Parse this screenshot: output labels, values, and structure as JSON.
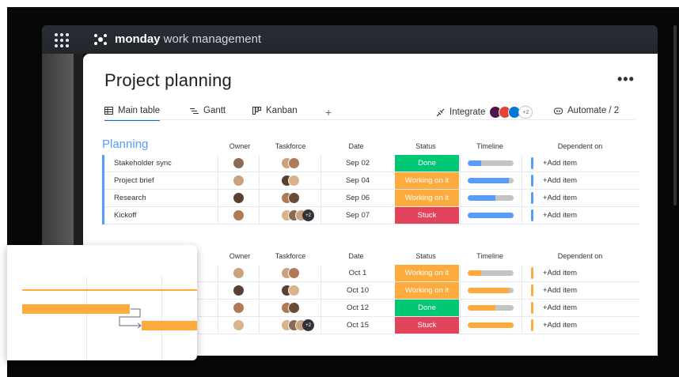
{
  "app": {
    "brand_bold": "monday",
    "brand_rest": " work management"
  },
  "page": {
    "title": "Project planning",
    "more_label": "•••"
  },
  "views": [
    {
      "label": "Main table"
    },
    {
      "label": "Gantt"
    },
    {
      "label": "Kanban"
    }
  ],
  "add_view": "+",
  "integrate": {
    "label": "Integrate",
    "count": "+2"
  },
  "automate": {
    "label": "Automate / 2"
  },
  "columns": {
    "owner": "Owner",
    "taskforce": "Taskforce",
    "date": "Date",
    "status": "Status",
    "timeline": "Timeline",
    "dependent": "Dependent on"
  },
  "groups": [
    {
      "title": "Planning",
      "color": "#579bfc",
      "rows": [
        {
          "name": "Stakeholder sync",
          "date": "Sep 02",
          "status": "Done",
          "status_color": "#00c875",
          "timeline": 0.3,
          "extra": "",
          "dep": "+Add item"
        },
        {
          "name": "Project brief",
          "date": "Sep 04",
          "status": "Working on it",
          "status_color": "#fdab3d",
          "timeline": 0.9,
          "extra": "",
          "dep": "+Add item"
        },
        {
          "name": "Research",
          "date": "Sep 06",
          "status": "Working on it",
          "status_color": "#fdab3d",
          "timeline": 0.6,
          "extra": "",
          "dep": "+Add item"
        },
        {
          "name": "Kickoff",
          "date": "Sep 07",
          "status": "Stuck",
          "status_color": "#e2445c",
          "timeline": 1.0,
          "extra": "+2",
          "dep": "+Add item"
        }
      ]
    },
    {
      "title": "",
      "color": "#fdab3d",
      "rows": [
        {
          "name": "",
          "date": "Oct 1",
          "status": "Working on it",
          "status_color": "#fdab3d",
          "timeline": 0.3,
          "extra": "",
          "dep": "+Add item"
        },
        {
          "name": "",
          "date": "Oct 10",
          "status": "Working on it",
          "status_color": "#fdab3d",
          "timeline": 0.9,
          "extra": "",
          "dep": "+Add item"
        },
        {
          "name": "",
          "date": "Oct 12",
          "status": "Done",
          "status_color": "#00c875",
          "timeline": 0.6,
          "extra": "",
          "dep": "+Add item"
        },
        {
          "name": "",
          "date": "Oct 15",
          "status": "Stuck",
          "status_color": "#e2445c",
          "timeline": 1.0,
          "extra": "+2",
          "dep": "+Add item"
        }
      ]
    }
  ],
  "colors": {
    "accent": "#0073ea",
    "done": "#00c875",
    "working": "#fdab3d",
    "stuck": "#e2445c"
  }
}
